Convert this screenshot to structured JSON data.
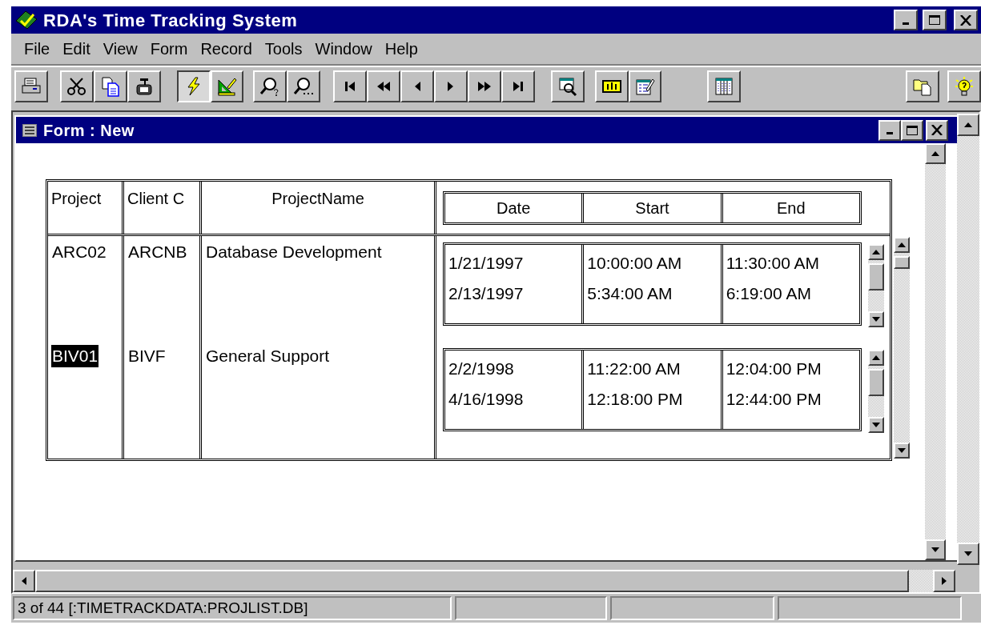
{
  "window": {
    "title": "RDA's Time Tracking System"
  },
  "menu": [
    {
      "label": "File"
    },
    {
      "label": "Edit"
    },
    {
      "label": "View"
    },
    {
      "label": "Form"
    },
    {
      "label": "Record"
    },
    {
      "label": "Tools"
    },
    {
      "label": "Window"
    },
    {
      "label": "Help"
    }
  ],
  "toolbar": [
    {
      "pressed": false
    },
    {
      "pressed": false
    },
    {
      "pressed": false
    },
    {
      "pressed": false
    },
    {
      "pressed": true
    },
    {
      "pressed": false
    },
    {
      "pressed": false
    },
    {
      "pressed": false
    },
    {
      "pressed": false
    },
    {
      "pressed": false
    },
    {
      "pressed": false
    },
    {
      "pressed": false
    },
    {
      "pressed": false
    },
    {
      "pressed": false
    },
    {
      "pressed": false
    },
    {
      "pressed": false
    },
    {
      "pressed": false
    },
    {
      "pressed": false
    },
    {
      "pressed": false
    },
    {
      "pressed": false
    }
  ],
  "form": {
    "title": "Form : New",
    "columns": [
      "Project",
      "Client C",
      "ProjectName"
    ],
    "sub_columns": [
      "Date",
      "Start",
      "End"
    ],
    "rows": [
      {
        "project": "ARC02",
        "client": "ARCNB",
        "name": "Database Development",
        "selected": false,
        "entries": [
          {
            "date": "1/21/1997",
            "start": "10:00:00 AM",
            "end": "11:30:00 AM"
          },
          {
            "date": "2/13/1997",
            "start": "5:34:00 AM",
            "end": "6:19:00 AM"
          }
        ]
      },
      {
        "project": "BIV01",
        "client": "BIVF",
        "name": "General Support",
        "selected": true,
        "entries": [
          {
            "date": "2/2/1998",
            "start": "11:22:00 AM",
            "end": "12:04:00 PM"
          },
          {
            "date": "4/16/1998",
            "start": "12:18:00 PM",
            "end": "12:44:00 PM"
          }
        ]
      }
    ]
  },
  "status_bar": [
    "3 of 44 [:TIMETRACKDATA:PROJLIST.DB]"
  ]
}
